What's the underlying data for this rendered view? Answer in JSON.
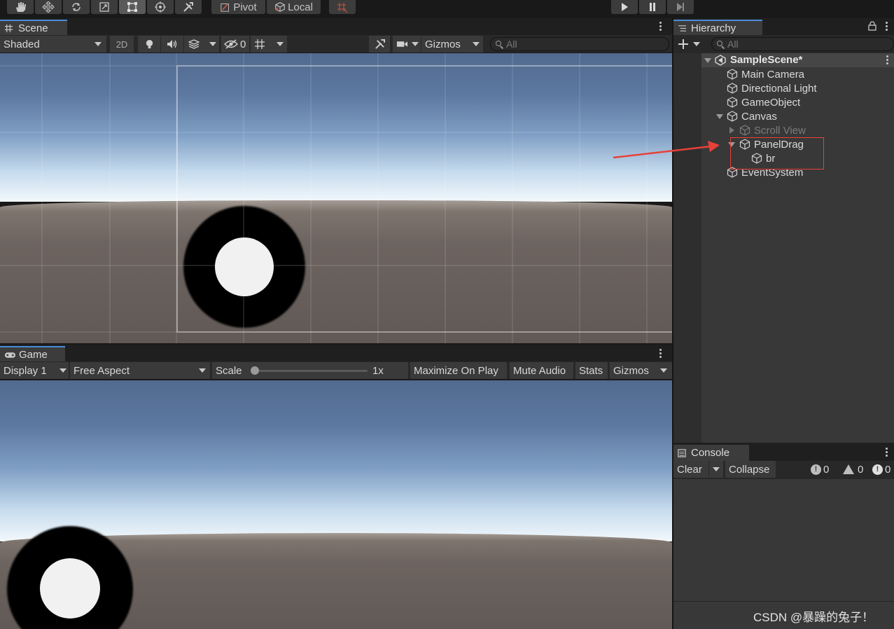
{
  "toolbar": {
    "tools": [
      "hand-icon",
      "move-icon",
      "rotate-icon",
      "scale-icon",
      "rect-tool-icon",
      "transform-icon",
      "custom-tools-icon"
    ],
    "pivot_label": "Pivot",
    "local_label": "Local",
    "play": [
      "play-icon",
      "pause-icon",
      "step-icon"
    ]
  },
  "scene": {
    "tab_label": "Scene",
    "shading_mode": "Shaded",
    "mode_2d": "2D",
    "hidden_count": "0",
    "gizmos_label": "Gizmos",
    "search_placeholder": "All"
  },
  "game": {
    "tab_label": "Game",
    "display": "Display 1",
    "aspect": "Free Aspect",
    "scale_label": "Scale",
    "scale_value": "1x",
    "scale_fraction": 0.0,
    "maximize_label": "Maximize On Play",
    "mute_label": "Mute Audio",
    "stats_label": "Stats",
    "gizmos_label": "Gizmos"
  },
  "hierarchy": {
    "tab_label": "Hierarchy",
    "search_placeholder": "All",
    "scene_name": "SampleScene*",
    "items": [
      {
        "label": "Main Camera"
      },
      {
        "label": "Directional Light"
      },
      {
        "label": "GameObject"
      },
      {
        "label": "Canvas"
      },
      {
        "label": "Scroll View"
      },
      {
        "label": "PanelDrag"
      },
      {
        "label": "br"
      },
      {
        "label": "EventSystem"
      }
    ]
  },
  "console": {
    "tab_label": "Console",
    "clear_label": "Clear",
    "collapse_label": "Collapse",
    "info_count": "0",
    "warning_count": "0",
    "error_count": "0"
  },
  "watermark": "CSDN @暴躁的兔子！",
  "colors": {
    "accent_tab": "#4a8bd6",
    "annotation": "#e8413a"
  }
}
